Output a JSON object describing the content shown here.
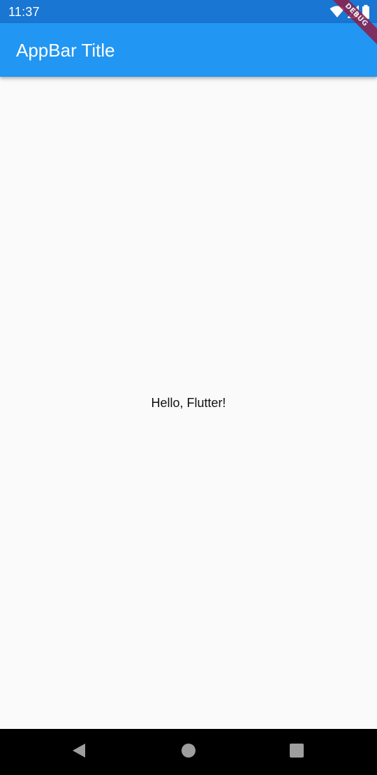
{
  "status_bar": {
    "time": "11:37",
    "icons": [
      "wifi-icon",
      "signal-icon",
      "battery-icon"
    ]
  },
  "app_bar": {
    "title": "AppBar Title",
    "color": "#2196f3"
  },
  "body": {
    "text": "Hello, Flutter!"
  },
  "debug_banner": {
    "label": "DEBUG"
  },
  "nav_bar": {
    "buttons": [
      "back-icon",
      "home-icon",
      "recents-icon"
    ]
  },
  "colors": {
    "status_bar": "#1976d2",
    "app_bar": "#2196f3",
    "background": "#fafafa",
    "debug_banner": "#8e1e48"
  }
}
